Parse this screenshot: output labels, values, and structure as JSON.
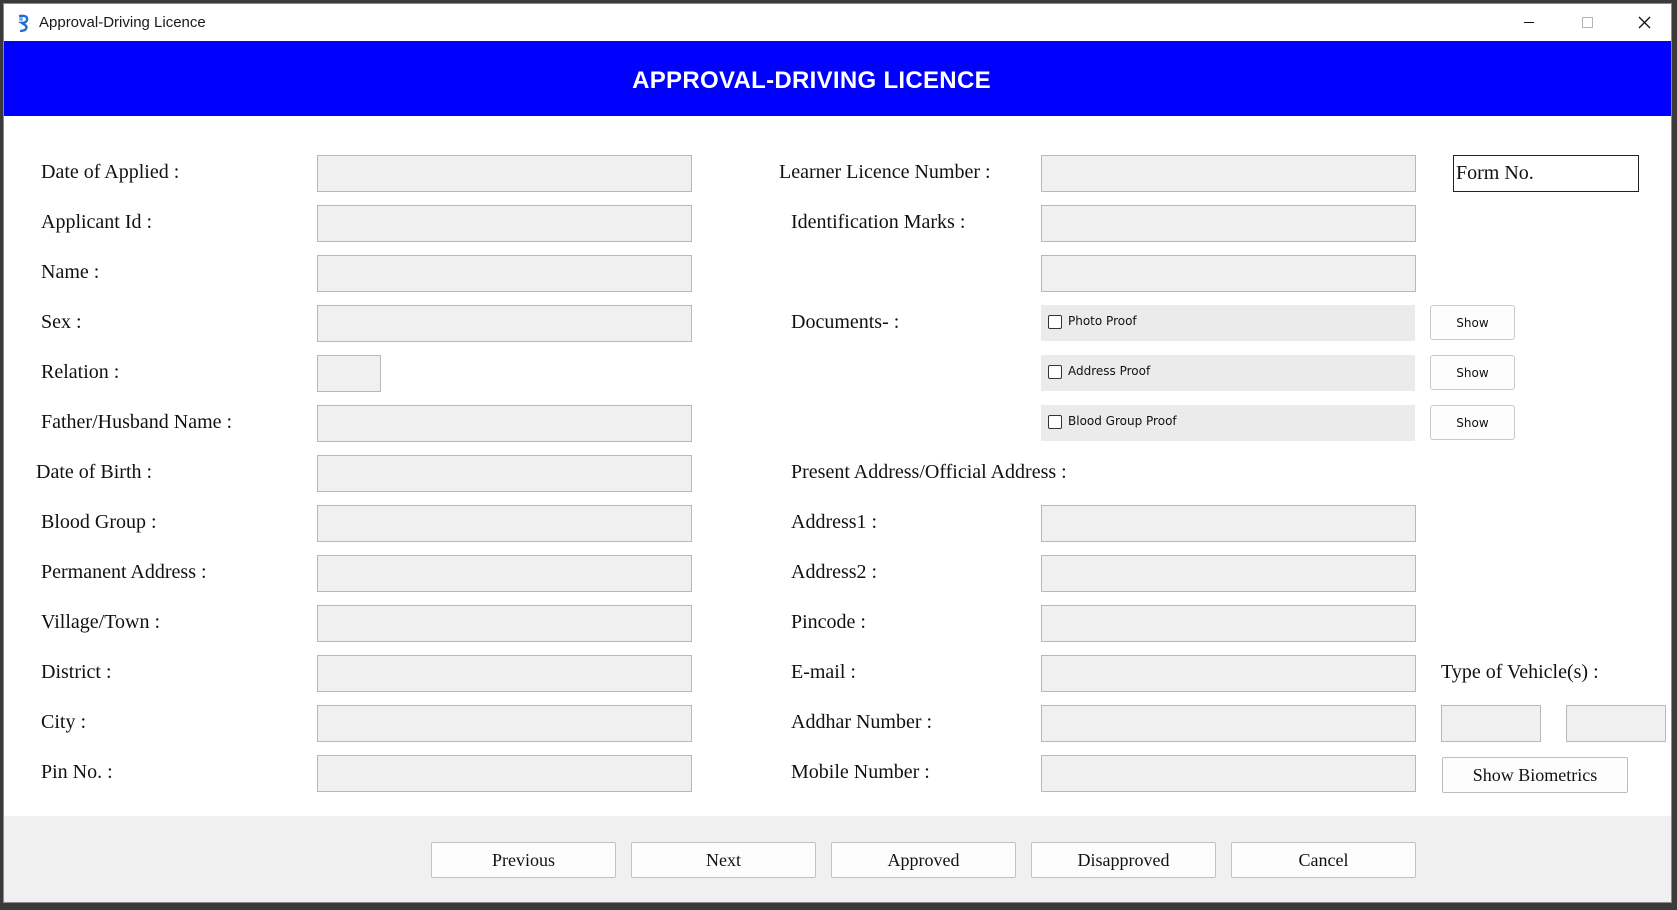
{
  "window": {
    "title": "Approval-Driving Licence"
  },
  "banner": {
    "title": "APPROVAL-DRIVING LICENCE"
  },
  "left_fields": [
    {
      "label": "Date of Applied :",
      "value": ""
    },
    {
      "label": "Applicant Id :",
      "value": ""
    },
    {
      "label": "Name :",
      "value": ""
    },
    {
      "label": "Sex :",
      "value": ""
    },
    {
      "label": "Relation :",
      "value": ""
    },
    {
      "label": "Father/Husband Name :",
      "value": ""
    },
    {
      "label": "Date of Birth :",
      "value": ""
    },
    {
      "label": "Blood Group :",
      "value": ""
    },
    {
      "label": "Permanent Address :",
      "value": ""
    },
    {
      "label": "Village/Town :",
      "value": ""
    },
    {
      "label": "District :",
      "value": ""
    },
    {
      "label": "City :",
      "value": ""
    },
    {
      "label": "Pin No. :",
      "value": ""
    }
  ],
  "right_fields": {
    "learner_licence_number": {
      "label": "Learner Licence Number :",
      "value": ""
    },
    "identification_marks": {
      "label": "Identification Marks :",
      "value1": "",
      "value2": ""
    },
    "documents_label": "Documents- :",
    "documents": [
      {
        "label": "Photo Proof",
        "checked": false,
        "button": "Show"
      },
      {
        "label": "Address Proof",
        "checked": false,
        "button": "Show"
      },
      {
        "label": "Blood Group Proof",
        "checked": false,
        "button": "Show"
      }
    ],
    "present_address_heading": "Present Address/Official Address :",
    "address1": {
      "label": "Address1 :",
      "value": ""
    },
    "address2": {
      "label": "Address2 :",
      "value": ""
    },
    "pincode": {
      "label": "Pincode :",
      "value": ""
    },
    "email": {
      "label": "E-mail :",
      "value": ""
    },
    "aadhar": {
      "label": "Addhar Number :",
      "value": ""
    },
    "mobile": {
      "label": "Mobile Number :",
      "value": ""
    }
  },
  "form_no": {
    "label": "Form No."
  },
  "vehicle": {
    "label": "Type of Vehicle(s) :",
    "value1": "",
    "value2": ""
  },
  "biometrics_button": "Show Biometrics",
  "nav_buttons": {
    "previous": "Previous",
    "next": "Next",
    "approved": "Approved",
    "disapproved": "Disapproved",
    "cancel": "Cancel"
  },
  "colors": {
    "banner_bg": "#0000ff",
    "banner_text": "#ffffff",
    "field_bg": "#f0f0f0",
    "form_bg": "#ffffff"
  }
}
